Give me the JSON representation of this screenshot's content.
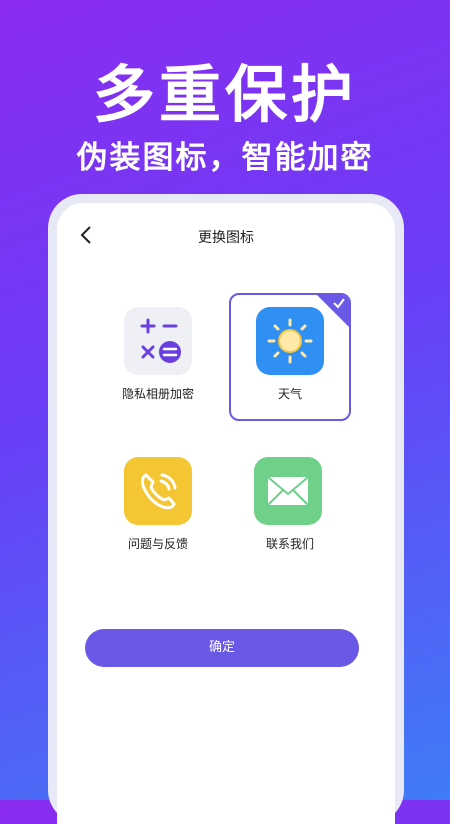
{
  "promo": {
    "headline": "多重保护",
    "subheadline": "伪装图标，智能加密"
  },
  "screen": {
    "title": "更换图标",
    "confirm_label": "确定"
  },
  "icons": [
    {
      "label": "隐私相册加密",
      "icon": "calculator-icon",
      "selected": false
    },
    {
      "label": "天气",
      "icon": "weather-sun-icon",
      "selected": true
    },
    {
      "label": "问题与反馈",
      "icon": "phone-call-icon",
      "selected": false
    },
    {
      "label": "联系我们",
      "icon": "mail-envelope-icon",
      "selected": false
    }
  ],
  "colors": {
    "accent": "#6a58e6",
    "background_top": "#8a2cf0",
    "background_bottom": "#3f7cf7",
    "weather_blue": "#2f8ff2",
    "call_yellow": "#f5c634",
    "mail_green": "#6fd08a"
  }
}
